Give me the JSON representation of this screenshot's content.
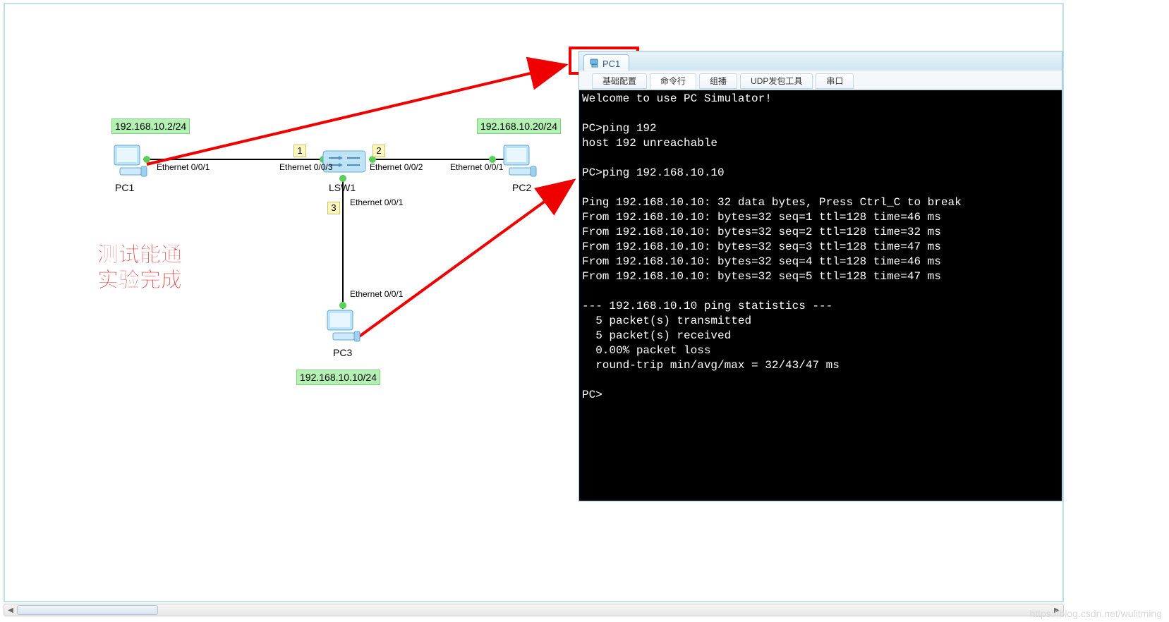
{
  "window": {
    "tab_title": "PC1"
  },
  "tabs": [
    "基础配置",
    "命令行",
    "组播",
    "UDP发包工具",
    "串口"
  ],
  "active_tab_index": 1,
  "topology": {
    "pc1": {
      "name": "PC1",
      "ip": "192.168.10.2/24",
      "port": "Ethernet 0/0/1"
    },
    "pc2": {
      "name": "PC2",
      "ip": "192.168.10.20/24",
      "port": "Ethernet 0/0/1"
    },
    "pc3": {
      "name": "PC3",
      "ip": "192.168.10.10/24",
      "port": "Ethernet 0/0/1"
    },
    "switch": {
      "name": "LSW1",
      "port_left": "Ethernet 0/0/3",
      "port_right": "Ethernet 0/0/2",
      "port_down": "Ethernet 0/0/1"
    },
    "link_labels": {
      "l1": "1",
      "l2": "2",
      "l3": "3"
    }
  },
  "annotation": {
    "line1": "测试能通",
    "line2": "实验完成"
  },
  "terminal_lines": [
    "Welcome to use PC Simulator!",
    "",
    "PC>ping 192",
    "host 192 unreachable",
    "",
    "PC>ping 192.168.10.10",
    "",
    "Ping 192.168.10.10: 32 data bytes, Press Ctrl_C to break",
    "From 192.168.10.10: bytes=32 seq=1 ttl=128 time=46 ms",
    "From 192.168.10.10: bytes=32 seq=2 ttl=128 time=32 ms",
    "From 192.168.10.10: bytes=32 seq=3 ttl=128 time=47 ms",
    "From 192.168.10.10: bytes=32 seq=4 ttl=128 time=46 ms",
    "From 192.168.10.10: bytes=32 seq=5 ttl=128 time=47 ms",
    "",
    "--- 192.168.10.10 ping statistics ---",
    "  5 packet(s) transmitted",
    "  5 packet(s) received",
    "  0.00% packet loss",
    "  round-trip min/avg/max = 32/43/47 ms",
    "",
    "PC>"
  ],
  "watermark": "https://blog.csdn.net/wulitming"
}
